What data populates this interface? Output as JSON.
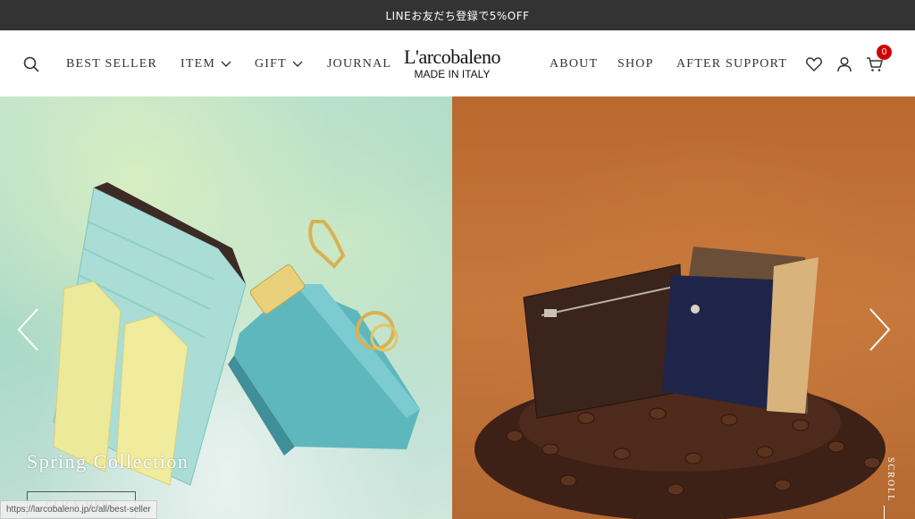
{
  "announcement": {
    "text": "LINEお友だち登録で5%OFF"
  },
  "header": {
    "nav_left": [
      {
        "label": "BEST SELLER"
      },
      {
        "label": "ITEM",
        "has_dropdown": true
      },
      {
        "label": "GIFT",
        "has_dropdown": true
      },
      {
        "label": "JOURNAL"
      }
    ],
    "logo": {
      "name": "L'arcobaleno",
      "tagline": "MADE IN ITALY"
    },
    "nav_right": [
      {
        "label": "ABOUT"
      },
      {
        "label": "SHOP"
      },
      {
        "label": "AFTER SUPPORT"
      }
    ],
    "icons": [
      "search-icon",
      "heart-icon",
      "user-icon",
      "cart-icon"
    ],
    "cart_count": "0",
    "cart_badge_color": "#d10000"
  },
  "hero": {
    "slide_title": "Spring Collection",
    "cta_label": "CLICK HERE",
    "scroll_label": "SCROLL",
    "left_bg_color": "#a8d8c8",
    "right_bg_color": "#c7783c"
  },
  "status_bar": {
    "url": "https://larcobaleno.jp/c/all/best-seller"
  }
}
